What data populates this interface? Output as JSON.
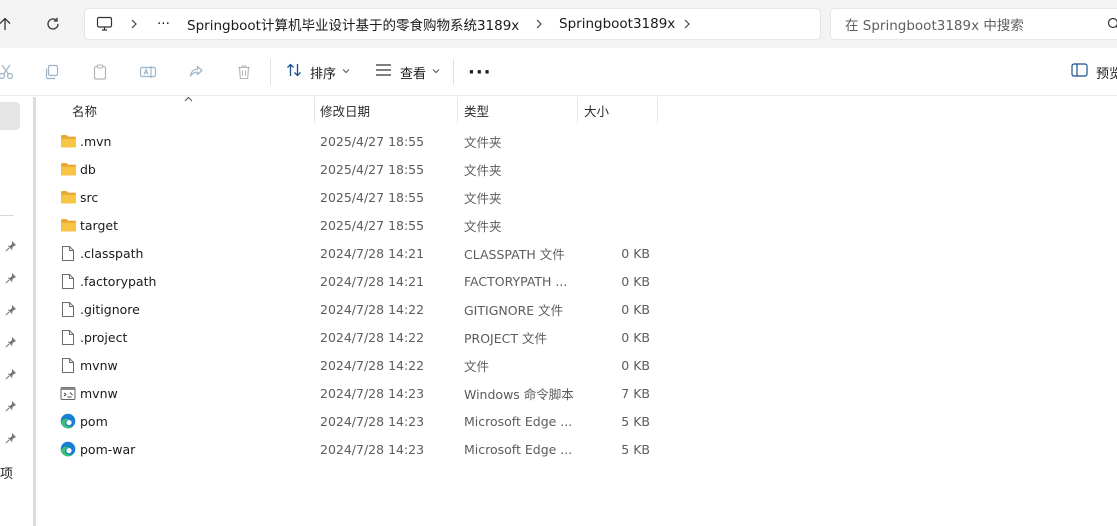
{
  "address": {
    "overflow": "···",
    "crumbs": [
      "Springboot计算机毕业设计基于的零食购物系统3189x",
      "Springboot3189x"
    ]
  },
  "search": {
    "placeholder": "在 Springboot3189x 中搜索"
  },
  "toolbar": {
    "sort_label": "排序",
    "view_label": "查看",
    "more_label": "···",
    "preview_label": "预览"
  },
  "nav": {
    "fragment": "项"
  },
  "columns": {
    "name": "名称",
    "date": "修改日期",
    "type": "类型",
    "size": "大小"
  },
  "files": [
    {
      "icon": "folder-icon",
      "name": ".mvn",
      "date": "2025/4/27 18:55",
      "type": "文件夹",
      "size": ""
    },
    {
      "icon": "folder-icon",
      "name": "db",
      "date": "2025/4/27 18:55",
      "type": "文件夹",
      "size": ""
    },
    {
      "icon": "folder-icon",
      "name": "src",
      "date": "2025/4/27 18:55",
      "type": "文件夹",
      "size": ""
    },
    {
      "icon": "folder-icon",
      "name": "target",
      "date": "2025/4/27 18:55",
      "type": "文件夹",
      "size": ""
    },
    {
      "icon": "file-icon",
      "name": ".classpath",
      "date": "2024/7/28 14:21",
      "type": "CLASSPATH 文件",
      "size": "0 KB"
    },
    {
      "icon": "file-icon",
      "name": ".factorypath",
      "date": "2024/7/28 14:21",
      "type": "FACTORYPATH ...",
      "size": "0 KB"
    },
    {
      "icon": "file-icon",
      "name": ".gitignore",
      "date": "2024/7/28 14:22",
      "type": "GITIGNORE 文件",
      "size": "0 KB"
    },
    {
      "icon": "file-icon",
      "name": ".project",
      "date": "2024/7/28 14:22",
      "type": "PROJECT 文件",
      "size": "0 KB"
    },
    {
      "icon": "file-icon",
      "name": "mvnw",
      "date": "2024/7/28 14:22",
      "type": "文件",
      "size": "0 KB"
    },
    {
      "icon": "script-icon",
      "name": "mvnw",
      "date": "2024/7/28 14:23",
      "type": "Windows 命令脚本",
      "size": "7 KB"
    },
    {
      "icon": "edge-icon",
      "name": "pom",
      "date": "2024/7/28 14:23",
      "type": "Microsoft Edge ...",
      "size": "5 KB"
    },
    {
      "icon": "edge-icon",
      "name": "pom-war",
      "date": "2024/7/28 14:23",
      "type": "Microsoft Edge ...",
      "size": "5 KB"
    }
  ],
  "colors": {
    "folder": "#f7c443",
    "edge_blue": "#1a7fd4",
    "edge_green": "#3cc36b",
    "selection": "#e5e5e5"
  }
}
